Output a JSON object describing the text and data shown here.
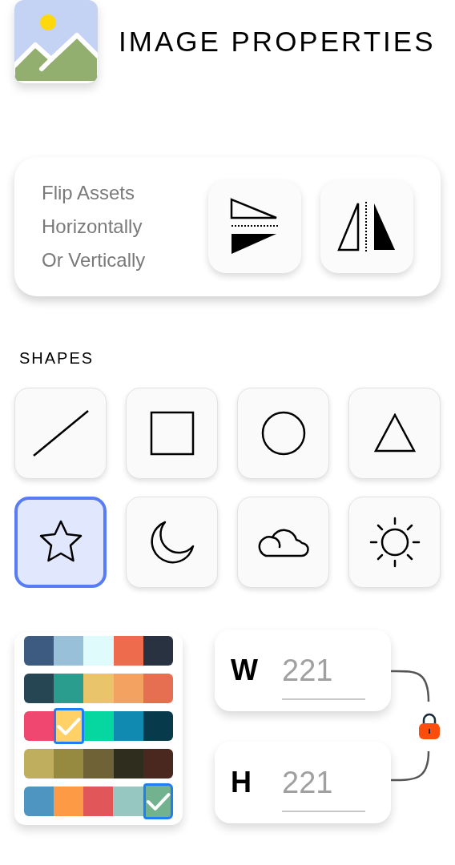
{
  "header": {
    "title": "IMAGE PROPERTIES"
  },
  "flip_card": {
    "text_lines": [
      "Flip Assets",
      "Horizontally",
      "Or Vertically"
    ],
    "buttons": [
      {
        "kind": "vertical"
      },
      {
        "kind": "horizontal"
      }
    ]
  },
  "shapes": {
    "label": "SHAPES",
    "items": [
      {
        "kind": "line",
        "selected": false
      },
      {
        "kind": "square",
        "selected": false
      },
      {
        "kind": "circle",
        "selected": false
      },
      {
        "kind": "triangle",
        "selected": false
      },
      {
        "kind": "star",
        "selected": true
      },
      {
        "kind": "moon",
        "selected": false
      },
      {
        "kind": "cloud",
        "selected": false
      },
      {
        "kind": "sun",
        "selected": false
      }
    ]
  },
  "palettes": [
    {
      "swatches": [
        {
          "color": "#3d5a80",
          "selected": false
        },
        {
          "color": "#98c1d9",
          "selected": false
        },
        {
          "color": "#e0fbfc",
          "selected": false
        },
        {
          "color": "#ee6c4d",
          "selected": false
        },
        {
          "color": "#293241",
          "selected": false
        }
      ]
    },
    {
      "swatches": [
        {
          "color": "#264653",
          "selected": false
        },
        {
          "color": "#2a9d8f",
          "selected": false
        },
        {
          "color": "#e9c46a",
          "selected": false
        },
        {
          "color": "#f4a261",
          "selected": false
        },
        {
          "color": "#e76f51",
          "selected": false
        }
      ]
    },
    {
      "swatches": [
        {
          "color": "#ef476f",
          "selected": false
        },
        {
          "color": "#ffd166",
          "selected": true
        },
        {
          "color": "#06d6a0",
          "selected": false
        },
        {
          "color": "#118ab2",
          "selected": false
        },
        {
          "color": "#073b4c",
          "selected": false
        }
      ]
    },
    {
      "swatches": [
        {
          "color": "#c0ae5f",
          "selected": false
        },
        {
          "color": "#958a3f",
          "selected": false
        },
        {
          "color": "#6e6236",
          "selected": false
        },
        {
          "color": "#2f2e1e",
          "selected": false
        },
        {
          "color": "#4a2820",
          "selected": false
        }
      ]
    },
    {
      "swatches": [
        {
          "color": "#4f95c2",
          "selected": false
        },
        {
          "color": "#fd9a45",
          "selected": false
        },
        {
          "color": "#e05659",
          "selected": false
        },
        {
          "color": "#97c7c1",
          "selected": false
        },
        {
          "color": "#72b28f",
          "selected": true
        }
      ]
    }
  ],
  "dimensions": {
    "fields": [
      {
        "label": "W",
        "value": "221"
      },
      {
        "label": "H",
        "value": "221"
      }
    ],
    "locked": true
  }
}
